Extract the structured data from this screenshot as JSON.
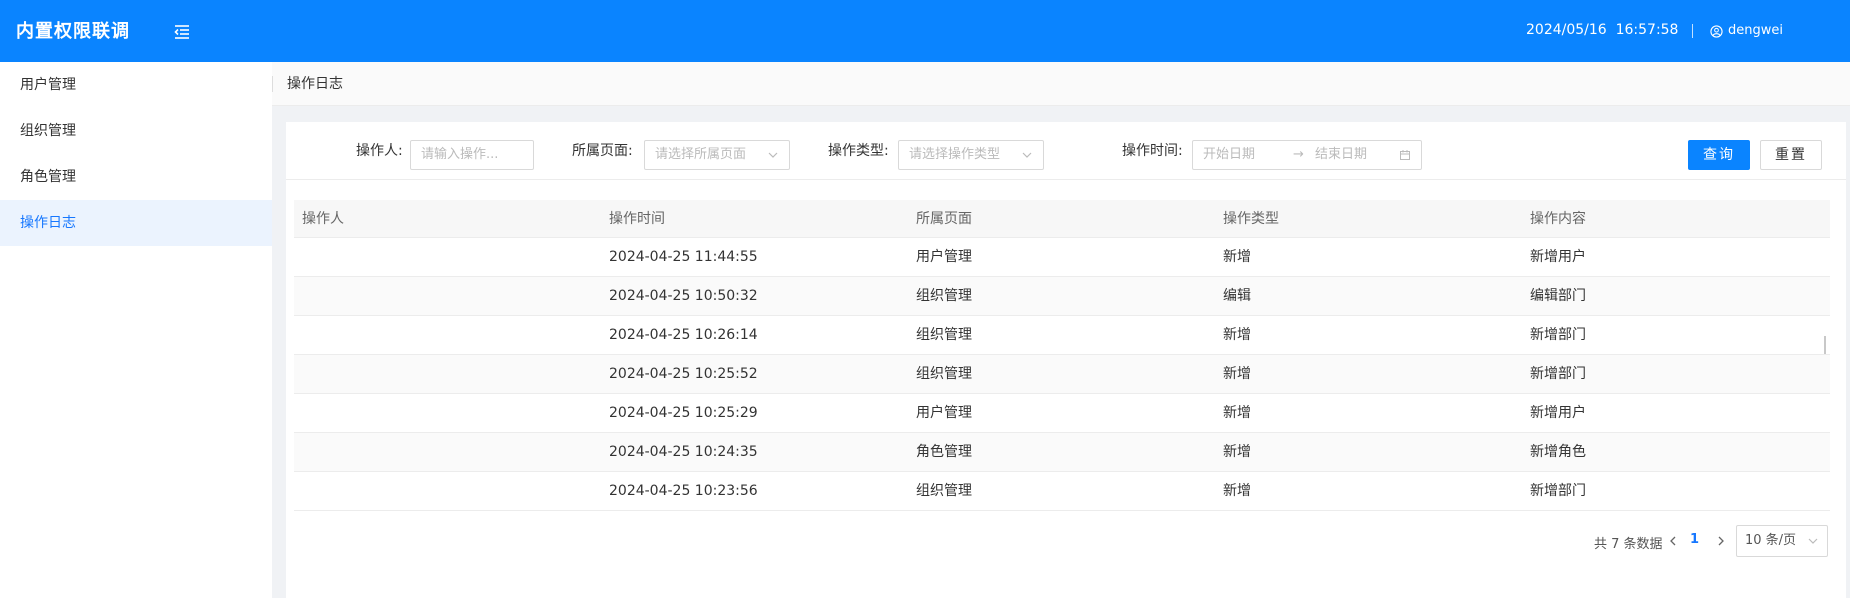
{
  "header": {
    "app_title": "内置权限联调",
    "datetime": "2024/05/16  16:57:58",
    "username": "dengwei"
  },
  "sidebar": {
    "items": [
      {
        "label": "用户管理"
      },
      {
        "label": "组织管理"
      },
      {
        "label": "角色管理"
      },
      {
        "label": "操作日志"
      }
    ],
    "active_index": 3
  },
  "breadcrumb": {
    "title": "操作日志"
  },
  "filters": {
    "operator_label": "操作人:",
    "operator_placeholder": "请输入操作...",
    "page_label": "所属页面:",
    "page_placeholder": "请选择所属页面",
    "type_label": "操作类型:",
    "type_placeholder": "请选择操作类型",
    "time_label": "操作时间:",
    "start_placeholder": "开始日期",
    "end_placeholder": "结束日期",
    "range_separator": "→",
    "query_button": "查询",
    "reset_button": "重置"
  },
  "table": {
    "columns": [
      "操作人",
      "操作时间",
      "所属页面",
      "操作类型",
      "操作内容"
    ],
    "rows": [
      [
        "",
        "2024-04-25 11:44:55",
        "用户管理",
        "新增",
        "新增用户"
      ],
      [
        "",
        "2024-04-25 10:50:32",
        "组织管理",
        "编辑",
        "编辑部门"
      ],
      [
        "",
        "2024-04-25 10:26:14",
        "组织管理",
        "新增",
        "新增部门"
      ],
      [
        "",
        "2024-04-25 10:25:52",
        "组织管理",
        "新增",
        "新增部门"
      ],
      [
        "",
        "2024-04-25 10:25:29",
        "用户管理",
        "新增",
        "新增用户"
      ],
      [
        "",
        "2024-04-25 10:24:35",
        "角色管理",
        "新增",
        "新增角色"
      ],
      [
        "",
        "2024-04-25 10:23:56",
        "组织管理",
        "新增",
        "新增部门"
      ]
    ]
  },
  "pagination": {
    "total_text": "共 7 条数据",
    "current_page": "1",
    "page_size": "10 条/页"
  },
  "colors": {
    "primary": "#0a84ff",
    "active_menu_bg": "#ebf3fe",
    "active_menu_text": "#1677ff"
  },
  "icons": {
    "menu_toggle": "menu-fold-icon",
    "user": "user-icon",
    "dropdown": "chevron-down-icon",
    "calendar": "calendar-icon",
    "prev": "chevron-left-icon",
    "next": "chevron-right-icon"
  }
}
